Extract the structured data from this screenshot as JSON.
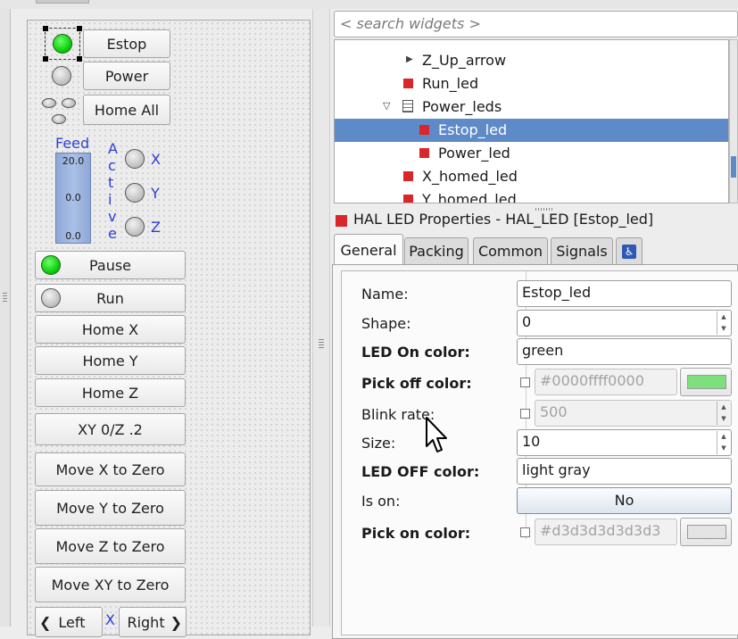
{
  "canvas": {
    "buttons": {
      "estop": "Estop",
      "power": "Power",
      "home_all": "Home All",
      "pause": "Pause",
      "run": "Run",
      "home_x": "Home X",
      "home_y": "Home Y",
      "home_z": "Home Z",
      "xy0_z2": "XY 0/Z .2",
      "move_x_zero": "Move X to Zero",
      "move_y_zero": "Move Y to Zero",
      "move_z_zero": "Move Z to Zero",
      "move_xy_zero": "Move XY to Zero",
      "left": "Left",
      "right": "Right"
    },
    "feed": {
      "label": "Feed",
      "max": "20.0",
      "mid": "0.0",
      "min": "0.0"
    },
    "active_letters": [
      "A",
      "c",
      "t",
      "i",
      "v",
      "e"
    ],
    "axes": [
      "X",
      "Y",
      "Z"
    ],
    "jog_axis": "X"
  },
  "search": {
    "placeholder": "< search widgets >"
  },
  "tree": {
    "items": [
      {
        "label": "Z_Up_arrow"
      },
      {
        "label": "Run_led"
      },
      {
        "label": "Power_leds"
      },
      {
        "label": "Estop_led"
      },
      {
        "label": "Power_led"
      },
      {
        "label": "X_homed_led"
      },
      {
        "label": "Y_homed_led"
      }
    ]
  },
  "properties": {
    "header": "HAL LED Properties - HAL_LED [Estop_led]",
    "tabs": [
      "General",
      "Packing",
      "Common",
      "Signals"
    ],
    "accessibility_icon": "accessibility-icon",
    "rows": {
      "name": {
        "label": "Name:",
        "value": "Estop_led"
      },
      "shape": {
        "label": "Shape:",
        "value": "0"
      },
      "on_color": {
        "label": "LED On color:",
        "value": "green"
      },
      "pick_off_color": {
        "label": "Pick off color:",
        "value": "#0000ffff0000"
      },
      "blink_rate": {
        "label": "Blink rate:",
        "value": "500"
      },
      "size": {
        "label": "Size:",
        "value": "10"
      },
      "off_color": {
        "label": "LED OFF color:",
        "value": "light gray"
      },
      "is_on": {
        "label": "Is on:",
        "value": "No"
      },
      "pick_on_color": {
        "label": "Pick on color:",
        "value": "#d3d3d3d3d3d3"
      }
    }
  },
  "colors": {
    "led_red": "#d9262a",
    "led_green": "#00c800",
    "selection": "#5f8ac8",
    "pick_off_swatch": "#7de07d",
    "pick_on_swatch": "#d3d3d3",
    "blue_label": "#2c3fd4"
  }
}
